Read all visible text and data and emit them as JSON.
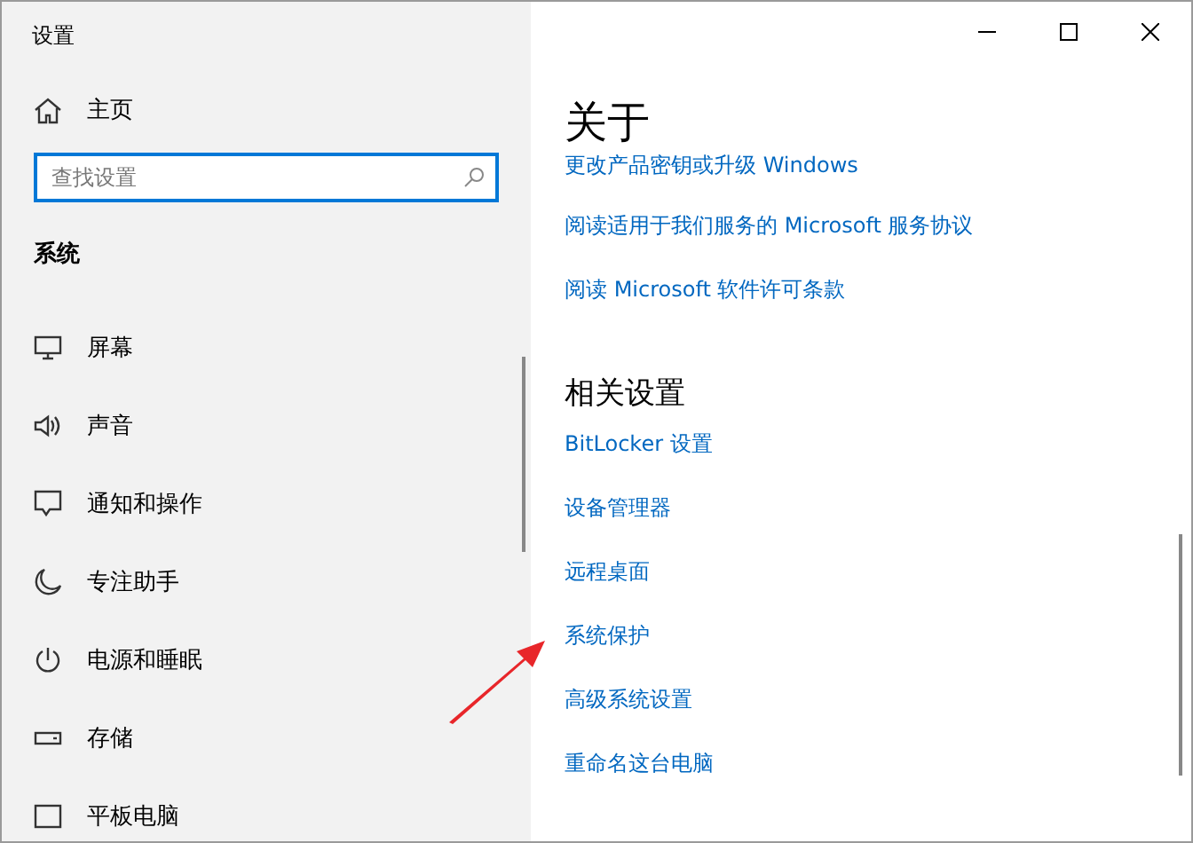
{
  "window": {
    "title": "设置"
  },
  "sidebar": {
    "home": "主页",
    "search": {
      "placeholder": "查找设置"
    },
    "section": "系统",
    "items": [
      {
        "label": "屏幕"
      },
      {
        "label": "声音"
      },
      {
        "label": "通知和操作"
      },
      {
        "label": "专注助手"
      },
      {
        "label": "电源和睡眠"
      },
      {
        "label": "存储"
      },
      {
        "label": "平板电脑"
      }
    ]
  },
  "main": {
    "title": "关于",
    "links": [
      "更改产品密钥或升级 Windows",
      "阅读适用于我们服务的 Microsoft 服务协议",
      "阅读 Microsoft 软件许可条款"
    ],
    "related": {
      "title": "相关设置",
      "links": [
        "BitLocker 设置",
        "设备管理器",
        "远程桌面",
        "系统保护",
        "高级系统设置",
        "重命名这台电脑"
      ]
    }
  }
}
